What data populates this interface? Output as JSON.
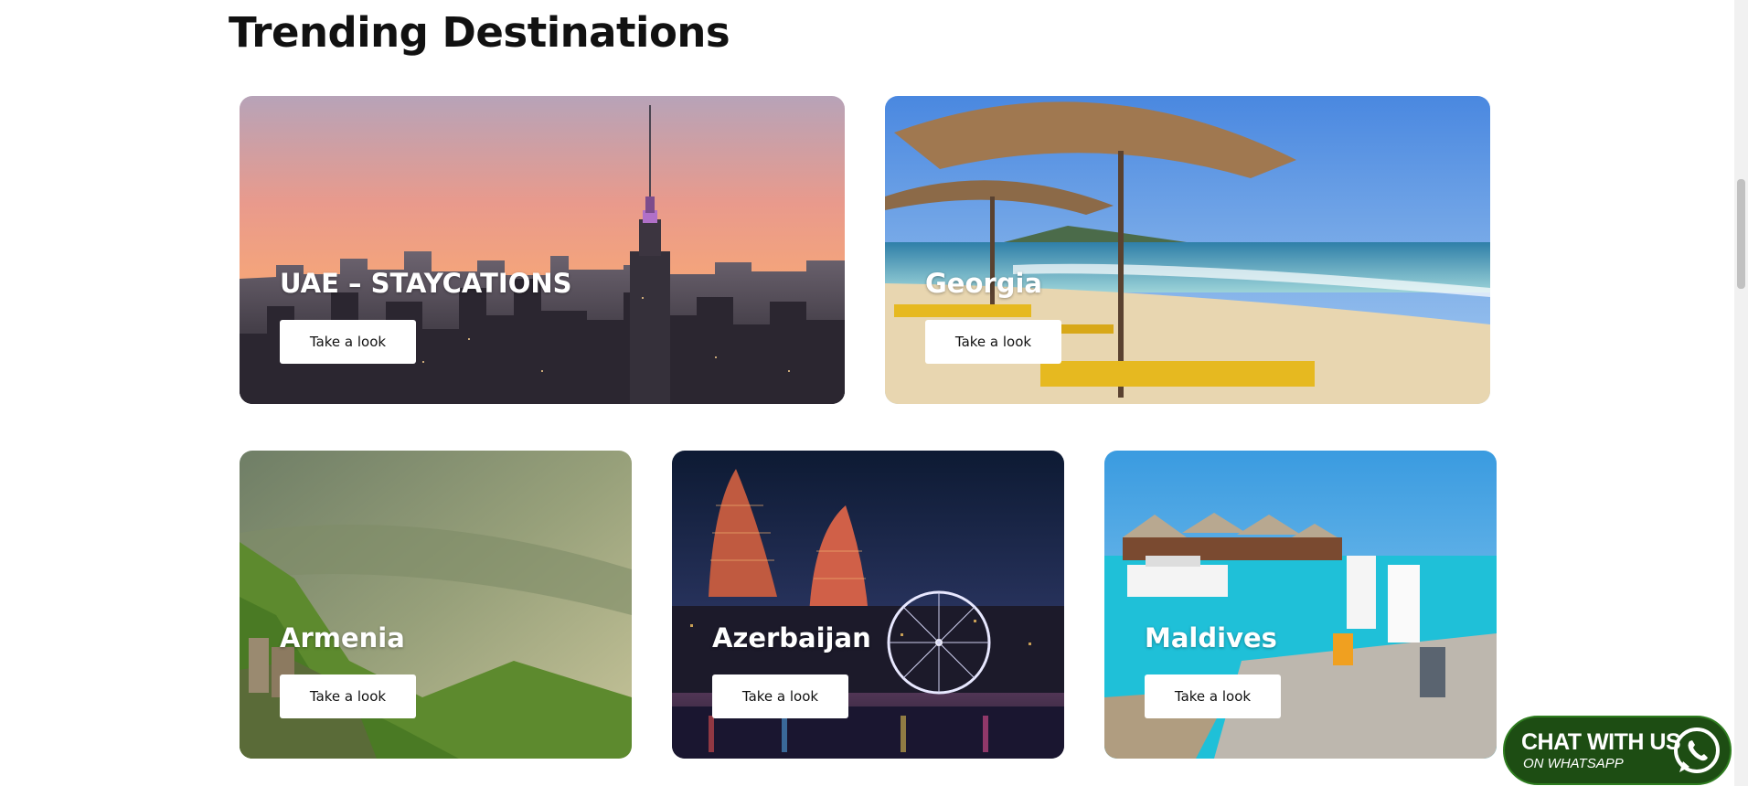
{
  "section": {
    "title": "Trending Destinations"
  },
  "cards": [
    {
      "name": "UAE – STAYCATIONS",
      "button": "Take a look"
    },
    {
      "name": "Georgia",
      "button": "Take a look"
    },
    {
      "name": "Armenia",
      "button": "Take a look"
    },
    {
      "name": "Azerbaijan",
      "button": "Take a look"
    },
    {
      "name": "Maldives",
      "button": "Take a look"
    }
  ],
  "whatsapp": {
    "main": "CHAT WITH US",
    "sub": "ON WHATSAPP",
    "color": "#1d4d13"
  },
  "icons": {
    "whatsapp": "whatsapp-icon"
  }
}
